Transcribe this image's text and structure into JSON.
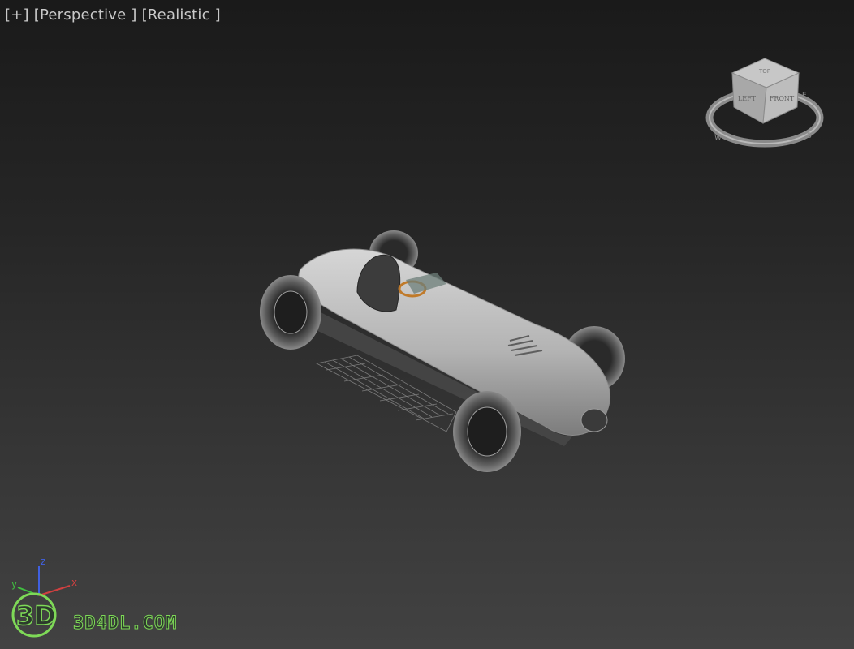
{
  "viewport": {
    "label_plus": "[+]",
    "label_view": "[Perspective ]",
    "label_shading": "[Realistic ]"
  },
  "viewcube": {
    "face_top": "TOP",
    "face_left": "LEFT",
    "face_front": "FRONT",
    "compass_w": "W",
    "compass_e": "E",
    "compass_s": "S"
  },
  "axis": {
    "x": "x",
    "y": "y",
    "z": "z"
  },
  "watermark": {
    "logo": "3D",
    "text": "3D4DL.COM"
  },
  "colors": {
    "background_top": "#1a1a1a",
    "background_bottom": "#424242",
    "model": "#b5b5b5",
    "label": "#c9c9c9",
    "axis_x": "#d04040",
    "axis_y": "#40c040",
    "axis_z": "#4060e0",
    "watermark": "#7ed957"
  },
  "icons": [
    "viewcube-icon",
    "axis-tripod-icon",
    "watermark-logo-icon"
  ]
}
